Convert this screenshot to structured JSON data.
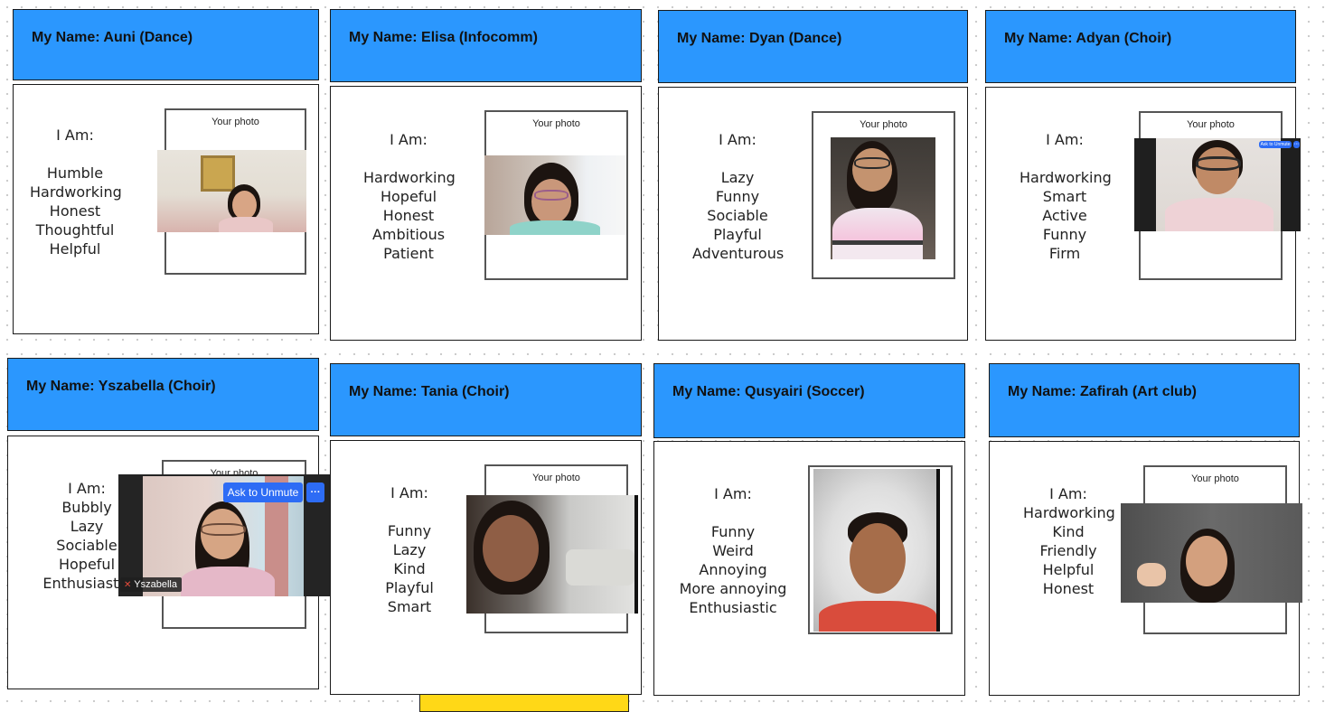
{
  "photo_label": "Your photo",
  "cards": [
    {
      "title": "My Name: Auni (Dance)",
      "iam": "I Am:",
      "traits": [
        "Humble",
        "Hardworking",
        "Honest",
        "Thoughtful",
        "Helpful"
      ]
    },
    {
      "title": "My Name: Elisa (Infocomm)",
      "iam": "I Am:",
      "traits": [
        "Hardworking",
        "Hopeful",
        "Honest",
        "Ambitious",
        "Patient"
      ]
    },
    {
      "title": "My Name: Dyan (Dance)",
      "iam": "I Am:",
      "traits": [
        "Lazy",
        "Funny",
        "Sociable",
        "Playful",
        "Adventurous"
      ]
    },
    {
      "title": "My Name: Adyan (Choir)",
      "iam": "I Am:",
      "traits": [
        "Hardworking",
        "Smart",
        "Active",
        "Funny",
        "Firm"
      ]
    },
    {
      "title": "My Name: Yszabella (Choir)",
      "iam": "I Am:",
      "traits": [
        "Bubbly",
        "Lazy",
        "Sociable",
        "Hopeful",
        "Enthusiastic"
      ]
    },
    {
      "title": "My Name: Tania (Choir)",
      "iam": "I Am:",
      "traits": [
        "Funny",
        "Lazy",
        "Kind",
        "Playful",
        "Smart"
      ]
    },
    {
      "title": "My Name: Qusyairi (Soccer)",
      "iam": "I Am:",
      "traits": [
        "Funny",
        "Weird",
        "Annoying",
        "More annoying",
        "Enthusiastic"
      ]
    },
    {
      "title": "My Name: Zafirah (Art club)",
      "iam": "I Am:",
      "traits": [
        "Hardworking",
        "Kind",
        "Friendly",
        "Helpful",
        "Honest"
      ]
    }
  ],
  "video_overlay": {
    "ask_to_unmute": "Ask to Unmute",
    "more": "···",
    "participant": "Yszabella",
    "small_ask": "Ask to Unmute"
  },
  "colors": {
    "header": "#2b97fe",
    "sticky": "#ffd817",
    "zoom_button": "#2d6cf5"
  }
}
